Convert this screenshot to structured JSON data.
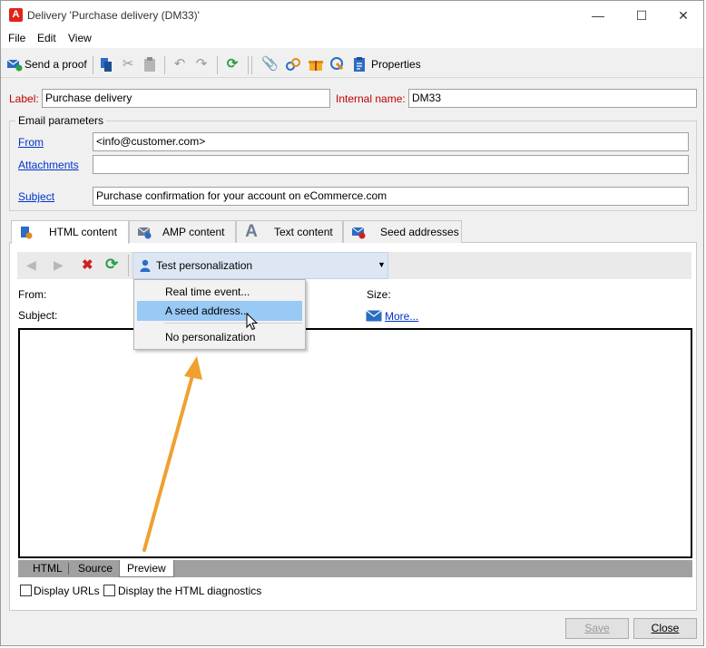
{
  "window": {
    "title": "Delivery 'Purchase delivery (DM33)'",
    "controls": {
      "minimize": "—",
      "maximize": "☐",
      "close": "✕"
    }
  },
  "menu": {
    "items": [
      "File",
      "Edit",
      "View"
    ]
  },
  "toolbar": {
    "send_proof_label": "Send a proof",
    "properties_label": "Properties"
  },
  "general": {
    "label_caption": "Label:",
    "label_value": "Purchase delivery",
    "internal_name_caption": "Internal name:",
    "internal_name_value": "DM33"
  },
  "email_parameters": {
    "group_title": "Email parameters",
    "from_label": "From",
    "from_value": "<info@customer.com>",
    "attachments_label": "Attachments",
    "attachments_value": "",
    "subject_label": "Subject",
    "subject_value": "Purchase confirmation for your account on eCommerce.com"
  },
  "tabs": [
    {
      "label": "HTML content",
      "active": true
    },
    {
      "label": "AMP content",
      "active": false
    },
    {
      "label": "Text content",
      "active": false
    },
    {
      "label": "Seed addresses",
      "active": false
    }
  ],
  "content_toolbar": {
    "personalization_label": "Test personalization"
  },
  "dropdown": {
    "items": [
      "Real time event...",
      "A seed address...",
      "No personalization"
    ],
    "highlighted_index": 1
  },
  "preview_info": {
    "from_label": "From:",
    "subject_label": "Subject:",
    "size_label": "Size:",
    "more_link": "More..."
  },
  "bottom_tabs": [
    {
      "label": "HTML",
      "active": false
    },
    {
      "label": "Source",
      "active": false
    },
    {
      "label": "Preview",
      "active": true
    }
  ],
  "options": {
    "display_urls": "Display URLs",
    "display_diagnostics": "Display the HTML diagnostics"
  },
  "buttons": {
    "save": "Save",
    "close": "Close"
  },
  "colors": {
    "accent_orange": "#f0a030",
    "required_label": "#c00000",
    "link": "#0033cc",
    "menu_highlight": "#99c9f5"
  }
}
